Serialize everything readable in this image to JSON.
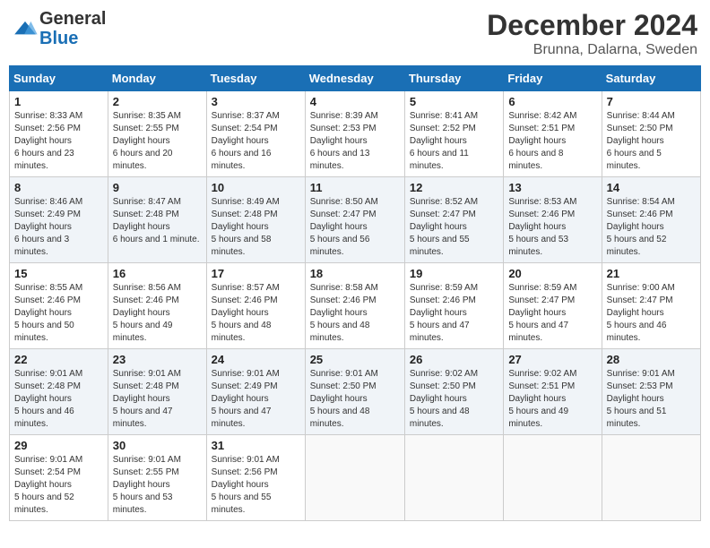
{
  "header": {
    "logo_general": "General",
    "logo_blue": "Blue",
    "month_title": "December 2024",
    "location": "Brunna, Dalarna, Sweden"
  },
  "days_of_week": [
    "Sunday",
    "Monday",
    "Tuesday",
    "Wednesday",
    "Thursday",
    "Friday",
    "Saturday"
  ],
  "weeks": [
    [
      {
        "day": 1,
        "sunrise": "8:33 AM",
        "sunset": "2:56 PM",
        "daylight": "6 hours and 23 minutes."
      },
      {
        "day": 2,
        "sunrise": "8:35 AM",
        "sunset": "2:55 PM",
        "daylight": "6 hours and 20 minutes."
      },
      {
        "day": 3,
        "sunrise": "8:37 AM",
        "sunset": "2:54 PM",
        "daylight": "6 hours and 16 minutes."
      },
      {
        "day": 4,
        "sunrise": "8:39 AM",
        "sunset": "2:53 PM",
        "daylight": "6 hours and 13 minutes."
      },
      {
        "day": 5,
        "sunrise": "8:41 AM",
        "sunset": "2:52 PM",
        "daylight": "6 hours and 11 minutes."
      },
      {
        "day": 6,
        "sunrise": "8:42 AM",
        "sunset": "2:51 PM",
        "daylight": "6 hours and 8 minutes."
      },
      {
        "day": 7,
        "sunrise": "8:44 AM",
        "sunset": "2:50 PM",
        "daylight": "6 hours and 5 minutes."
      }
    ],
    [
      {
        "day": 8,
        "sunrise": "8:46 AM",
        "sunset": "2:49 PM",
        "daylight": "6 hours and 3 minutes."
      },
      {
        "day": 9,
        "sunrise": "8:47 AM",
        "sunset": "2:48 PM",
        "daylight": "6 hours and 1 minute."
      },
      {
        "day": 10,
        "sunrise": "8:49 AM",
        "sunset": "2:48 PM",
        "daylight": "5 hours and 58 minutes."
      },
      {
        "day": 11,
        "sunrise": "8:50 AM",
        "sunset": "2:47 PM",
        "daylight": "5 hours and 56 minutes."
      },
      {
        "day": 12,
        "sunrise": "8:52 AM",
        "sunset": "2:47 PM",
        "daylight": "5 hours and 55 minutes."
      },
      {
        "day": 13,
        "sunrise": "8:53 AM",
        "sunset": "2:46 PM",
        "daylight": "5 hours and 53 minutes."
      },
      {
        "day": 14,
        "sunrise": "8:54 AM",
        "sunset": "2:46 PM",
        "daylight": "5 hours and 52 minutes."
      }
    ],
    [
      {
        "day": 15,
        "sunrise": "8:55 AM",
        "sunset": "2:46 PM",
        "daylight": "5 hours and 50 minutes."
      },
      {
        "day": 16,
        "sunrise": "8:56 AM",
        "sunset": "2:46 PM",
        "daylight": "5 hours and 49 minutes."
      },
      {
        "day": 17,
        "sunrise": "8:57 AM",
        "sunset": "2:46 PM",
        "daylight": "5 hours and 48 minutes."
      },
      {
        "day": 18,
        "sunrise": "8:58 AM",
        "sunset": "2:46 PM",
        "daylight": "5 hours and 48 minutes."
      },
      {
        "day": 19,
        "sunrise": "8:59 AM",
        "sunset": "2:46 PM",
        "daylight": "5 hours and 47 minutes."
      },
      {
        "day": 20,
        "sunrise": "8:59 AM",
        "sunset": "2:47 PM",
        "daylight": "5 hours and 47 minutes."
      },
      {
        "day": 21,
        "sunrise": "9:00 AM",
        "sunset": "2:47 PM",
        "daylight": "5 hours and 46 minutes."
      }
    ],
    [
      {
        "day": 22,
        "sunrise": "9:01 AM",
        "sunset": "2:48 PM",
        "daylight": "5 hours and 46 minutes."
      },
      {
        "day": 23,
        "sunrise": "9:01 AM",
        "sunset": "2:48 PM",
        "daylight": "5 hours and 47 minutes."
      },
      {
        "day": 24,
        "sunrise": "9:01 AM",
        "sunset": "2:49 PM",
        "daylight": "5 hours and 47 minutes."
      },
      {
        "day": 25,
        "sunrise": "9:01 AM",
        "sunset": "2:50 PM",
        "daylight": "5 hours and 48 minutes."
      },
      {
        "day": 26,
        "sunrise": "9:02 AM",
        "sunset": "2:50 PM",
        "daylight": "5 hours and 48 minutes."
      },
      {
        "day": 27,
        "sunrise": "9:02 AM",
        "sunset": "2:51 PM",
        "daylight": "5 hours and 49 minutes."
      },
      {
        "day": 28,
        "sunrise": "9:01 AM",
        "sunset": "2:53 PM",
        "daylight": "5 hours and 51 minutes."
      }
    ],
    [
      {
        "day": 29,
        "sunrise": "9:01 AM",
        "sunset": "2:54 PM",
        "daylight": "5 hours and 52 minutes."
      },
      {
        "day": 30,
        "sunrise": "9:01 AM",
        "sunset": "2:55 PM",
        "daylight": "5 hours and 53 minutes."
      },
      {
        "day": 31,
        "sunrise": "9:01 AM",
        "sunset": "2:56 PM",
        "daylight": "5 hours and 55 minutes."
      },
      null,
      null,
      null,
      null
    ]
  ]
}
